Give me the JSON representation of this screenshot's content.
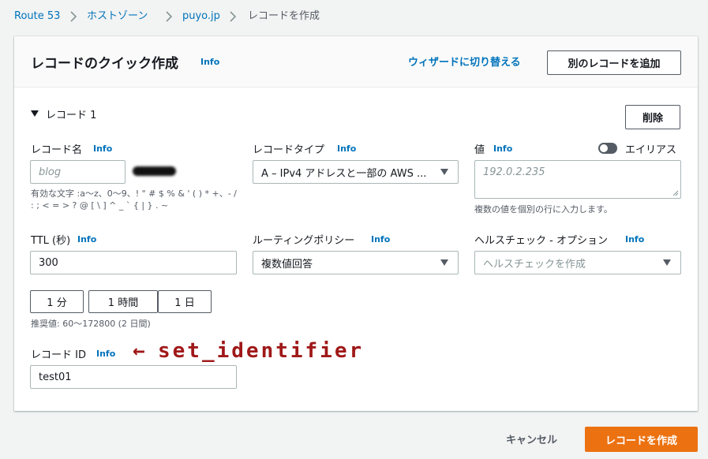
{
  "breadcrumb": {
    "items": [
      "Route 53",
      "ホストゾーン",
      "puyo.jp"
    ],
    "current": "レコードを作成"
  },
  "panel": {
    "title": "レコードのクイック作成",
    "info": "Info",
    "wizard_link": "ウィザードに切り替える",
    "add_record_button": "別のレコードを追加"
  },
  "record": {
    "section_title": "レコード 1",
    "delete_button": "削除",
    "name": {
      "label": "レコード名",
      "info": "Info",
      "placeholder": "blog",
      "hint": "有効な文字 :a〜z、0〜9、! \" # $ % & ' ( ) * +、- / : ; < = > ? @ [ \\ ] ^ _ ` { | } . ~"
    },
    "type": {
      "label": "レコードタイプ",
      "info": "Info",
      "value": "A – IPv4 アドレスと一部の AWS ..."
    },
    "value": {
      "label": "値",
      "info": "Info",
      "placeholder": "192.0.2.235",
      "hint": "複数の値を個別の行に入力します。",
      "alias_label": "エイリアス"
    },
    "ttl": {
      "label": "TTL (秒)",
      "info": "Info",
      "value": "300",
      "presets": [
        "1 分",
        "1 時間",
        "1 日"
      ],
      "hint": "推奨値: 60〜172800 (2 日間)"
    },
    "routing": {
      "label": "ルーティングポリシー",
      "info": "Info",
      "value": "複数値回答"
    },
    "health": {
      "label": "ヘルスチェック - オプション",
      "info": "Info",
      "placeholder": "ヘルスチェックを作成"
    },
    "record_id": {
      "label": "レコード ID",
      "info": "Info",
      "value": "test01"
    }
  },
  "annotation": {
    "arrow": "←",
    "text": "set_identifier",
    "color": "#a01818"
  },
  "footer": {
    "cancel": "キャンセル",
    "create": "レコードを作成"
  },
  "colors": {
    "link": "#0073bb",
    "primary": "#ec7211"
  }
}
